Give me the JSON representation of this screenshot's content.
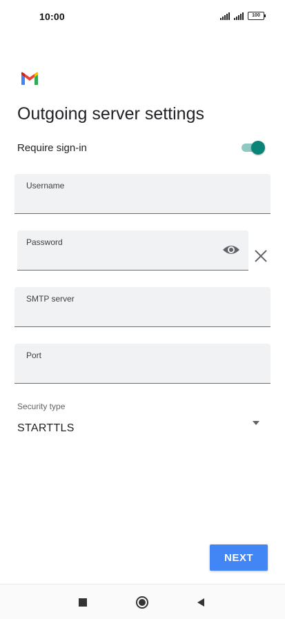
{
  "status_bar": {
    "time": "10:00",
    "battery": "100",
    "icons": [
      "signal-icon",
      "signal-icon",
      "battery-icon"
    ]
  },
  "app": {
    "logo": "gmail-logo",
    "title": "Outgoing server settings"
  },
  "require_signin": {
    "label": "Require sign-in",
    "enabled": true,
    "accent_color": "#0b8478"
  },
  "fields": {
    "username": {
      "label": "Username",
      "value": ""
    },
    "password": {
      "label": "Password",
      "value": ""
    },
    "smtp_server": {
      "label": "SMTP server",
      "value": ""
    },
    "port": {
      "label": "Port",
      "value": ""
    }
  },
  "security": {
    "label": "Security type",
    "selected": "STARTTLS"
  },
  "actions": {
    "next_label": "NEXT",
    "next_color": "#4285f4"
  },
  "nav": {
    "icons": [
      "recents-icon",
      "home-icon",
      "back-icon"
    ]
  }
}
